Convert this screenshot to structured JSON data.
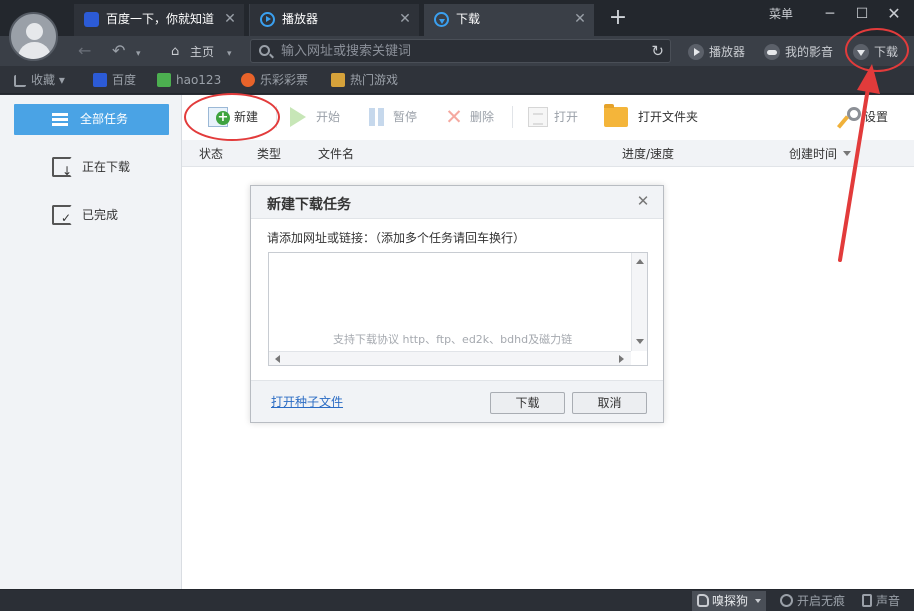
{
  "titlebar": {
    "tabs": [
      {
        "label": "百度一下，你就知道"
      },
      {
        "label": "播放器"
      },
      {
        "label": "下载"
      }
    ],
    "new_tab_label": "+",
    "menu_label": "菜单",
    "minimize": "─",
    "maximize": "☐",
    "close": "✕"
  },
  "navbar": {
    "back": "←",
    "undo": "↶",
    "caret": "▾",
    "home_icon": "⌂",
    "home_label": "主页",
    "url_placeholder": "输入网址或搜索关键词",
    "refresh": "↻",
    "player_label": "播放器",
    "my_videos_label": "我的影音",
    "download_label": "下载"
  },
  "favorites": [
    {
      "label": "收藏 ▾"
    },
    {
      "label": "百度"
    },
    {
      "label": "hao123"
    },
    {
      "label": "乐彩彩票"
    },
    {
      "label": "热门游戏"
    }
  ],
  "sidebar": {
    "all_tasks": "全部任务",
    "downloading": "正在下载",
    "completed": "已完成"
  },
  "toolbar": {
    "new": "新建",
    "start": "开始",
    "pause": "暂停",
    "delete": "删除",
    "open": "打开",
    "open_folder": "打开文件夹",
    "settings": "设置",
    "delete_icon": "✕"
  },
  "columns": {
    "status": "状态",
    "type": "类型",
    "filename": "文件名",
    "progress": "进度/速度",
    "created": "创建时间"
  },
  "dialog": {
    "title": "新建下载任务",
    "close": "✕",
    "prompt": "请添加网址或链接：（添加多个任务请回车换行）",
    "placeholder": "支持下载协议 http、ftp、ed2k、bdhd及磁力链",
    "torrent_link": "打开种子文件",
    "download_button": "下载",
    "cancel_button": "取消"
  },
  "statusbar": {
    "sniffer": "嗅探狗",
    "seamless": "开启无痕",
    "sound": "声音"
  },
  "colors": {
    "accent": "#4aa3e5",
    "annotation": "#e23b3b",
    "dark_bg": "#2b2f36"
  }
}
